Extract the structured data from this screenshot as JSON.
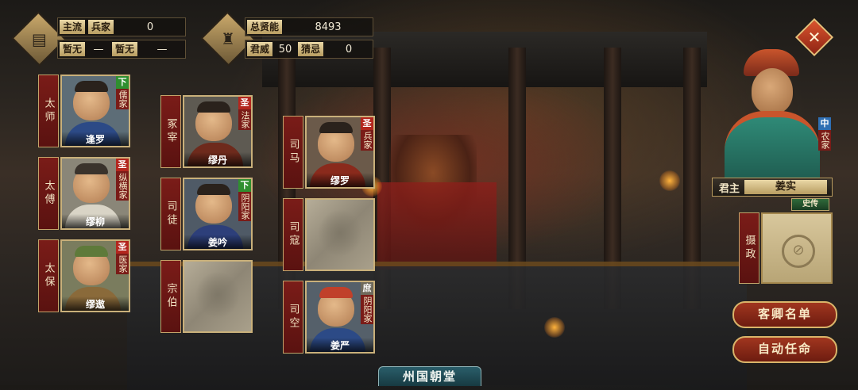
{
  "header": {
    "left": {
      "row1": {
        "label1": "主流",
        "label2": "兵家",
        "value": "0"
      },
      "row2": {
        "label1": "暂无",
        "dash1": "—",
        "label2": "暂无",
        "dash2": "—"
      }
    },
    "right": {
      "row1": {
        "label": "总贤能",
        "value": "8493"
      },
      "row2": {
        "label1": "君威",
        "value1": "50",
        "label2": "猜忌",
        "value2": "0"
      }
    }
  },
  "close_icon": "close-icon",
  "slots": [
    {
      "title": "太师",
      "name": "逢罗",
      "badge": "下",
      "badge_color": "#2f8f2f",
      "school": "儒家"
    },
    {
      "title": "太傅",
      "name": "缪柳",
      "badge": "圣",
      "badge_color": "#b3261e",
      "school": "纵横家"
    },
    {
      "title": "太保",
      "name": "缪遨",
      "badge": "圣",
      "badge_color": "#b3261e",
      "school": "医家"
    },
    {
      "title": "冢宰",
      "name": "缪丹",
      "badge": "圣",
      "badge_color": "#b3261e",
      "school": "法家"
    },
    {
      "title": "司徒",
      "name": "姜吟",
      "badge": "下",
      "badge_color": "#2f8f2f",
      "school": "阴阳家"
    },
    {
      "title": "宗伯",
      "name": "",
      "badge": "",
      "school": ""
    },
    {
      "title": "司马",
      "name": "缪罗",
      "badge": "圣",
      "badge_color": "#b3261e",
      "school": "兵家"
    },
    {
      "title": "司寇",
      "name": "",
      "badge": "",
      "school": ""
    },
    {
      "title": "司空",
      "name": "姜严",
      "badge": "庶",
      "badge_color": "#6f6a5c",
      "school": "阴阳家"
    }
  ],
  "lord": {
    "badge": "中",
    "school": "农家",
    "label": "君主",
    "name": "姜实",
    "history_label": "史传"
  },
  "regent": {
    "title": "摄政"
  },
  "buttons": {
    "guest_list": "客卿名单",
    "auto_assign": "自动任命"
  },
  "footer": {
    "title": "州国朝堂"
  }
}
